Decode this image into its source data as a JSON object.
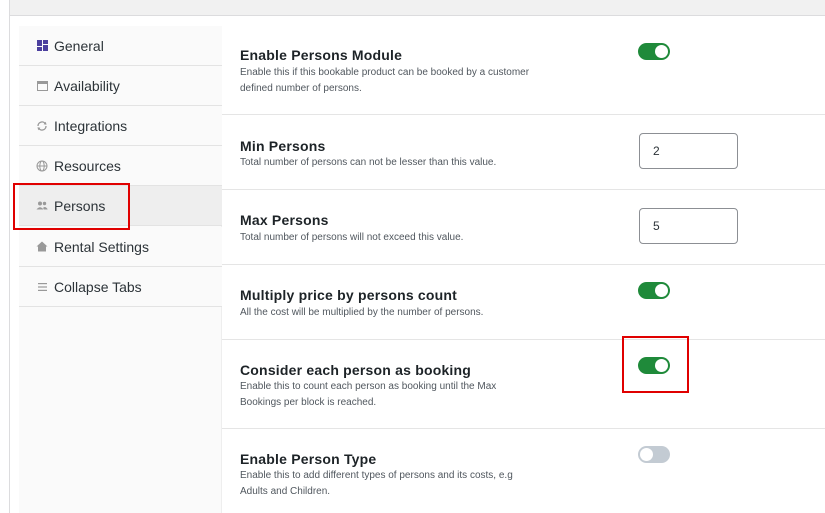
{
  "sidebar": {
    "items": [
      {
        "label": "General",
        "icon": "grid-icon"
      },
      {
        "label": "Availability",
        "icon": "calendar-icon"
      },
      {
        "label": "Integrations",
        "icon": "sync-icon"
      },
      {
        "label": "Resources",
        "icon": "globe-icon"
      },
      {
        "label": "Persons",
        "icon": "people-icon"
      },
      {
        "label": "Rental Settings",
        "icon": "home-icon"
      },
      {
        "label": "Collapse Tabs",
        "icon": "menu-icon"
      }
    ],
    "active": "Persons"
  },
  "settings": {
    "enable_persons": {
      "title": "Enable Persons Module",
      "description": "Enable this if this bookable product can be booked by a customer defined number of persons.",
      "enabled": true
    },
    "min_persons": {
      "title": "Min Persons",
      "description": "Total number of persons can not be lesser than this value.",
      "value": "2"
    },
    "max_persons": {
      "title": "Max Persons",
      "description": "Total number of persons will not exceed this value.",
      "value": "5"
    },
    "multiply_price": {
      "title": "Multiply price by persons count",
      "description": "All the cost will be multiplied by the number of persons.",
      "enabled": true
    },
    "each_person_booking": {
      "title": "Consider each person as booking",
      "description": "Enable this to count each person as booking until the Max Bookings per block is reached.",
      "enabled": true
    },
    "person_type": {
      "title": "Enable Person Type",
      "description": "Enable this to add different types of persons and its costs, e.g Adults and Children.",
      "enabled": false
    }
  },
  "colors": {
    "toggle_on": "#1f8a3a",
    "toggle_off": "#c3cbd3",
    "highlight": "#e00000",
    "general_icon": "#4b3f9e"
  }
}
